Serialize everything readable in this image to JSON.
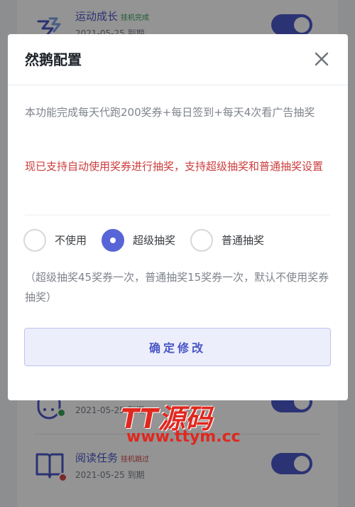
{
  "background": {
    "tasks": [
      {
        "title": "运动成长",
        "tag": "挂机完成",
        "date": "2021-05-25 到期"
      },
      {
        "title": "",
        "tag": "",
        "date": "2021-05-25 到期"
      },
      {
        "title": "阅读任务",
        "tag": "挂机跳过",
        "date": "2021-05-25 到期"
      }
    ]
  },
  "modal": {
    "title": "然鹅配置",
    "description": "本功能完成每天代跑200奖券+每日签到+每天4次看广告抽奖",
    "notice": "现已支持自动使用奖券进行抽奖，支持超级抽奖和普通抽奖设置",
    "options": [
      {
        "label": "不使用",
        "checked": false
      },
      {
        "label": "超级抽奖",
        "checked": true
      },
      {
        "label": "普通抽奖",
        "checked": false
      }
    ],
    "hint": "（超级抽奖45奖券一次，普通抽奖15奖券一次，默认不使用奖券抽奖）",
    "confirm_label": "确定修改"
  },
  "watermark": {
    "main": "TT源码",
    "url": "www.ttym.cc"
  },
  "colors": {
    "accent": "#5865d6",
    "notice": "#cc3d3d",
    "watermark": "#e0281f"
  }
}
